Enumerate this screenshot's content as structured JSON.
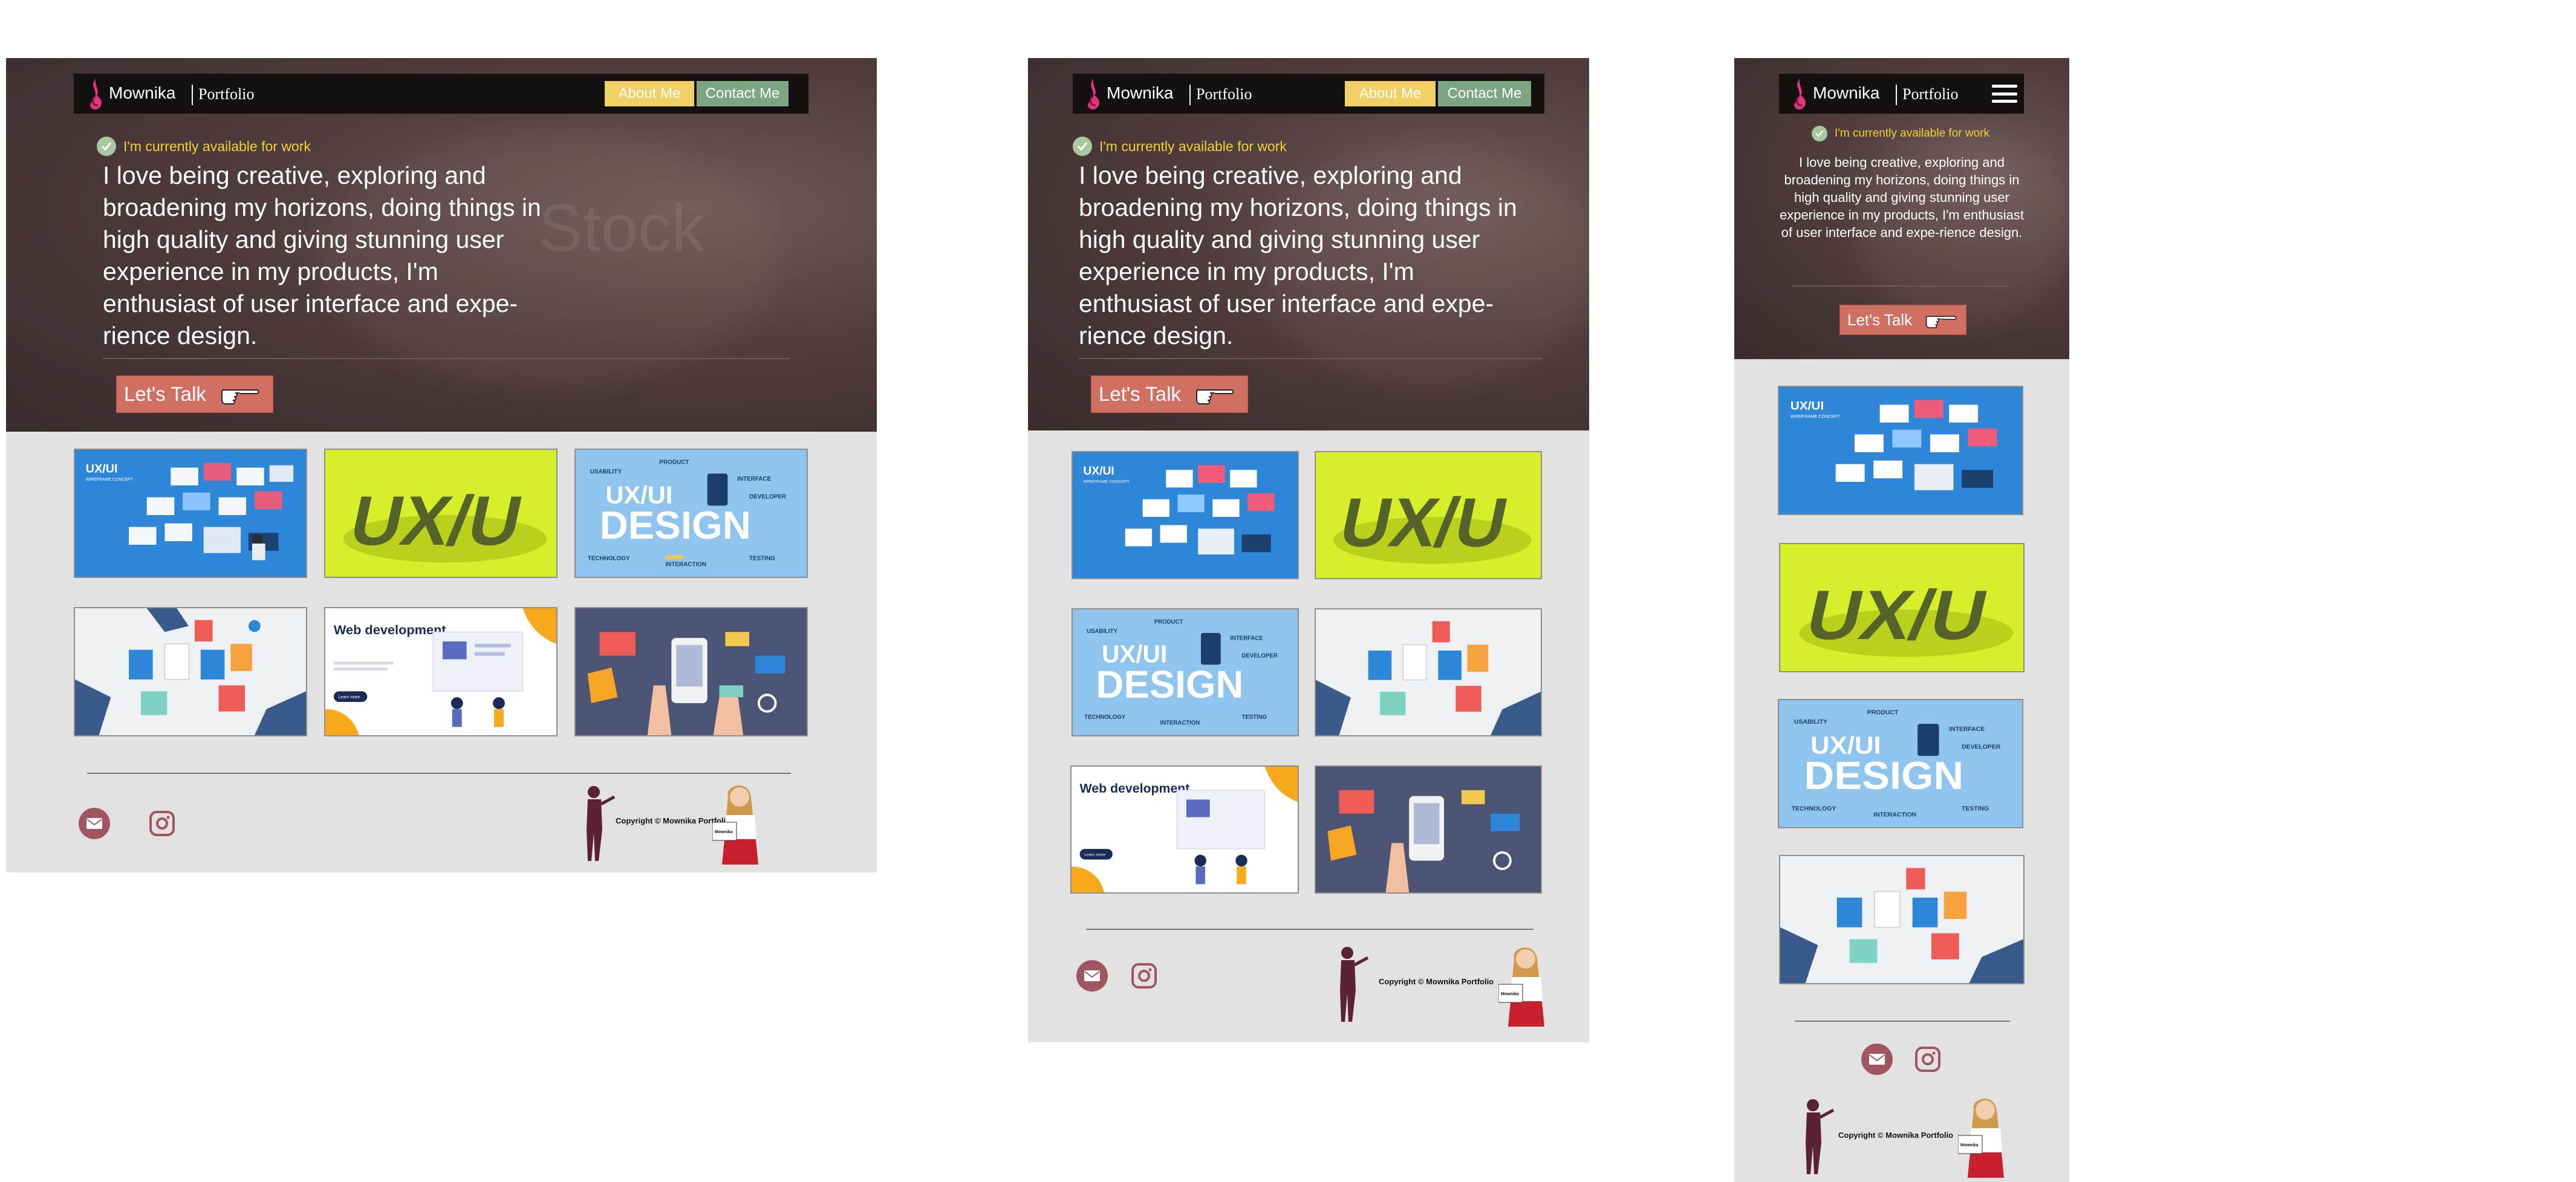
{
  "brand": {
    "name": "Mownika",
    "sub": "Portfolio"
  },
  "nav": {
    "about": "About Me",
    "contact": "Contact Me"
  },
  "hero": {
    "availability": "I'm currently available for work",
    "intro": "I love being creative, exploring and broadening my horizons, doing things in high quality and giving stunning user experience in my products, I'm enthusiast of user interface and expe-rience design.",
    "cta": "Let's Talk",
    "watermark": "Stock"
  },
  "cards": {
    "uxui_concept": {
      "title": "UX/UI",
      "subtitle": "WIREFRAME CONCEPT"
    },
    "uxui_3d": {
      "text": "UX/U"
    },
    "uxui_design": {
      "line1": "UX/UI",
      "line2": "DESIGN",
      "tags": [
        "USABILITY",
        "PRODUCT",
        "INTERFACE",
        "DEVELOPER",
        "TECHNOLOGY",
        "INTERACTION",
        "TESTING"
      ]
    },
    "webdev": {
      "title": "Web development",
      "button": "Learn more"
    }
  },
  "footer": {
    "copyright": "Copyright © Mownika Portfolio",
    "badge": "Mownika"
  },
  "colors": {
    "hero": "#4f3c3d",
    "page": "#e2e2e2",
    "navbar": "#141010",
    "about": "#f0cf64",
    "contact": "#7da583",
    "cta": "#cf7062",
    "availability": "#f2d230",
    "email": "#a05561",
    "brand_pink": "#e0347f"
  },
  "icons": [
    "flame-logo-icon",
    "check-icon",
    "pointing-hand-icon",
    "email-icon",
    "instagram-icon",
    "hamburger-menu-icon"
  ]
}
